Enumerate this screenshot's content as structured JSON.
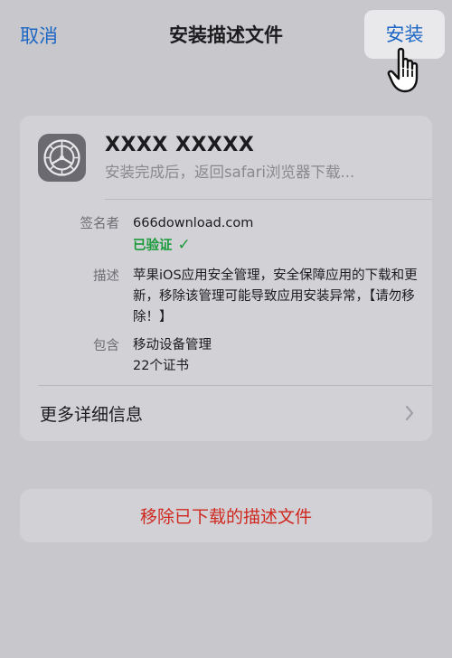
{
  "nav": {
    "cancel_label": "取消",
    "title": "安装描述文件",
    "install_label": "安装"
  },
  "profile": {
    "icon": "gear-icon",
    "name": "XXXX XXXXX",
    "subtitle": "安装完成后，返回safari浏览器下载...",
    "details": [
      {
        "label": "签名者",
        "value": "666download.com",
        "status": "已验证",
        "status_icon": "checkmark-icon"
      },
      {
        "label": "描述",
        "value": "苹果iOS应用安全管理，安全保障应用的下载和更新，移除该管理可能导致应用安装异常，【请勿移除！】"
      },
      {
        "label": "包含",
        "value": "移动设备管理",
        "value2": "22个证书"
      }
    ],
    "more_label": "更多详细信息"
  },
  "remove": {
    "label": "移除已下载的描述文件"
  },
  "colors": {
    "background": "#c7c7cc",
    "card": "#d1d1d6",
    "link": "#1d67c4",
    "verified": "#1a9a3a",
    "destructive": "#d0281f"
  }
}
